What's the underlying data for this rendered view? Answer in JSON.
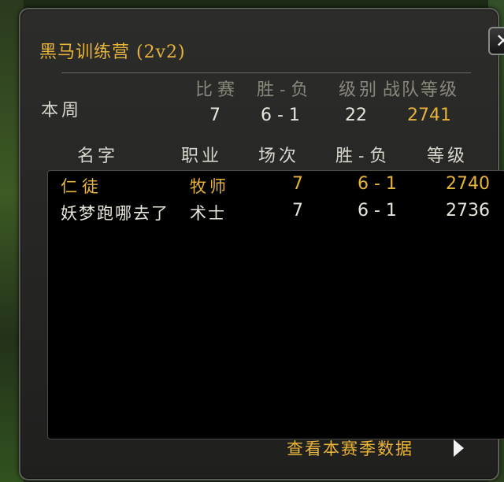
{
  "window": {
    "title": "黑马训练营 (2v2)",
    "close_label": "✕"
  },
  "weekly": {
    "row_label": "本周",
    "headers": {
      "matches": "比赛",
      "win_loss": "胜 - 负",
      "rank": "级别",
      "team_rating": "战队等级"
    },
    "values": {
      "matches": "7",
      "win_loss": "6 - 1",
      "rank": "22",
      "team_rating": "2741"
    }
  },
  "roster": {
    "headers": {
      "name": "名字",
      "class": "职业",
      "games": "场次",
      "win_loss": "胜 - 负",
      "rating": "等级"
    },
    "rows": [
      {
        "name": "仁徒",
        "class": "牧师",
        "games": "7",
        "win_loss": "6 - 1",
        "rating": "2740",
        "highlighted": true
      },
      {
        "name": "妖梦跑哪去了",
        "class": "术士",
        "games": "7",
        "win_loss": "6 - 1",
        "rating": "2736",
        "highlighted": false
      }
    ]
  },
  "footer": {
    "season_link": "查看本赛季数据"
  },
  "colors": {
    "accent": "#e6b43a",
    "text": "#e8e6dc",
    "panel": "#262625"
  }
}
